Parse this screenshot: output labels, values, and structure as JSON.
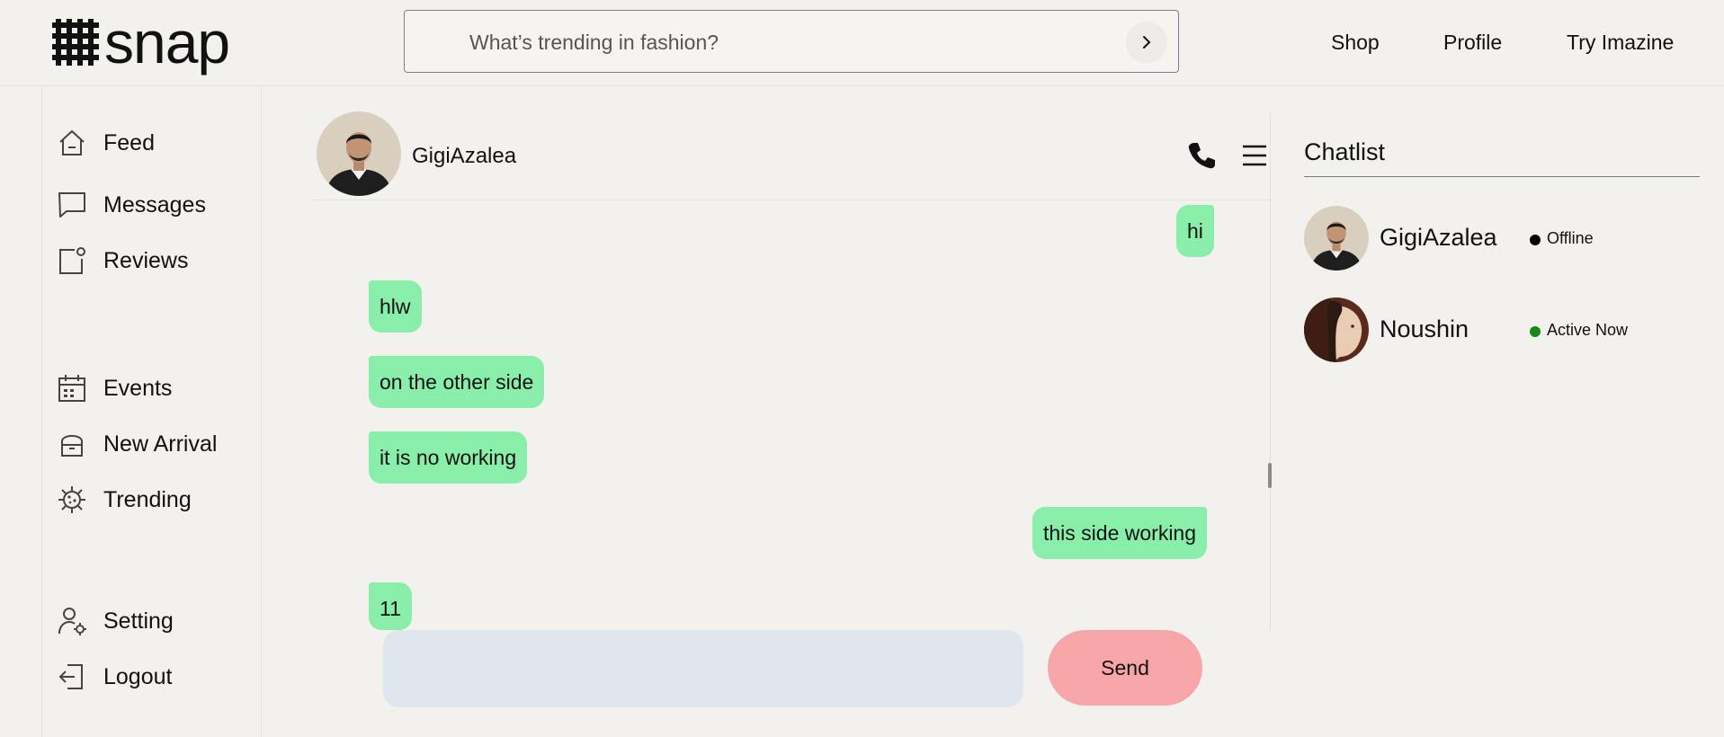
{
  "brand": {
    "name": "snap"
  },
  "search": {
    "placeholder": "What’s trending in fashion?"
  },
  "top_nav": [
    "Shop",
    "Profile",
    "Try Imazine"
  ],
  "sidebar": {
    "items": [
      {
        "label": "Feed",
        "icon": "home-icon"
      },
      {
        "label": "Messages",
        "icon": "message-icon"
      },
      {
        "label": "Reviews",
        "icon": "review-icon"
      },
      {
        "label": "Events",
        "icon": "calendar-icon"
      },
      {
        "label": "New Arrival",
        "icon": "store-icon"
      },
      {
        "label": "Trending",
        "icon": "trending-icon"
      },
      {
        "label": "Setting",
        "icon": "user-settings-icon"
      },
      {
        "label": "Logout",
        "icon": "logout-icon"
      }
    ]
  },
  "chat": {
    "contact_name": "GigiAzalea",
    "messages": [
      {
        "text": "hi",
        "side": "right"
      },
      {
        "text": "hlw",
        "side": "left"
      },
      {
        "text": "on the other side",
        "side": "left"
      },
      {
        "text": "it is no working",
        "side": "left"
      },
      {
        "text": "this side working",
        "side": "right"
      },
      {
        "text": "11",
        "side": "left"
      }
    ],
    "input_value": "",
    "send_label": "Send",
    "bubble_color": "#88eeaa",
    "send_color": "#f6a6a6"
  },
  "chatlist": {
    "title": "Chatlist",
    "contacts": [
      {
        "name": "GigiAzalea",
        "status": "Offline",
        "status_color": "#000000"
      },
      {
        "name": "Noushin",
        "status": "Active Now",
        "status_color": "#138a13"
      }
    ]
  }
}
